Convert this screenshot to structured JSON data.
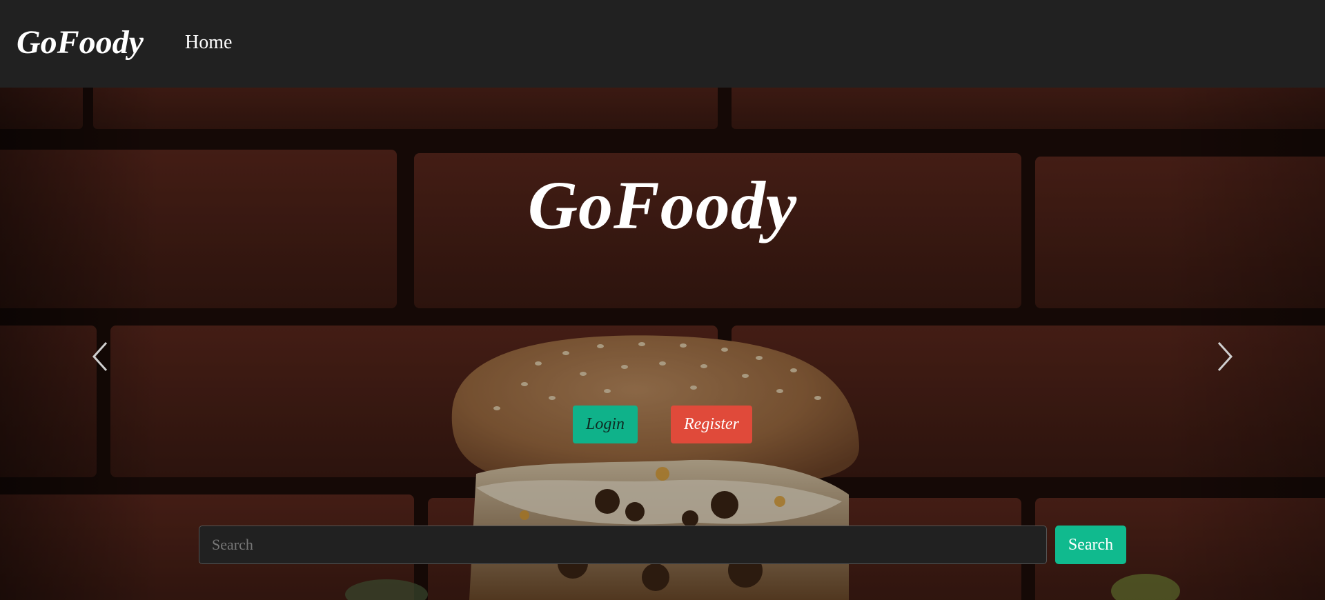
{
  "navbar": {
    "brand": "GoFoody",
    "links": [
      {
        "label": "Home"
      }
    ]
  },
  "hero": {
    "title": "GoFoody",
    "login_label": "Login",
    "register_label": "Register",
    "search_placeholder": "Search",
    "search_value": "",
    "search_button_label": "Search",
    "prev_icon": "chevron-left-icon",
    "next_icon": "chevron-right-icon",
    "background_image": "burger-on-brick-wall"
  },
  "colors": {
    "navbar_bg": "#212121",
    "login_bg": "#0fb28a",
    "register_bg": "#e04a3a",
    "search_button_bg": "#10ba8e",
    "text": "#ffffff"
  }
}
